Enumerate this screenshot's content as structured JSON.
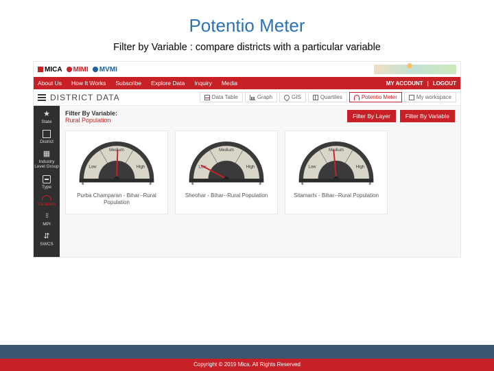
{
  "slide": {
    "title": "Potentio Meter",
    "subtitle": "Filter by Variable : compare districts with a particular variable"
  },
  "logos": {
    "mica": "MICA",
    "mimi": "MIMI",
    "mvmi": "MVMI"
  },
  "topnav": {
    "items": [
      "About Us",
      "How It Works",
      "Subscribe",
      "Explore Data",
      "Inquiry",
      "Media"
    ],
    "account": "MY ACCOUNT",
    "logout": "LOGOUT",
    "sep": " | "
  },
  "page_header": {
    "title": "DISTRICT DATA"
  },
  "viewtabs": [
    {
      "label": "Data Table",
      "active": false
    },
    {
      "label": "Graph",
      "active": false
    },
    {
      "label": "GIS",
      "active": false
    },
    {
      "label": "Quartiles",
      "active": false
    },
    {
      "label": "Potentio Meter",
      "active": true
    },
    {
      "label": "My workspace",
      "active": false
    }
  ],
  "sidenav": [
    {
      "label": "State"
    },
    {
      "label": "District"
    },
    {
      "label": "Industry Level Group"
    },
    {
      "label": "Type"
    },
    {
      "label": "Variables",
      "active": true
    },
    {
      "label": "MPI"
    },
    {
      "label": "SWCS"
    }
  ],
  "filter": {
    "label": "Filter By Variable:",
    "value": "Rural Population"
  },
  "buttons": {
    "by_layer": "Filter By Layer",
    "by_variable": "Filter By Variable"
  },
  "gauge_labels": {
    "low": "Low",
    "medium": "Medium",
    "high": "High"
  },
  "gauges": [
    {
      "caption": "Purba Champaran - Bihar--Rural Population",
      "zone": "medium",
      "angle": 88
    },
    {
      "caption": "Sheohar - Bihar--Rural Population",
      "zone": "low",
      "angle": 152
    },
    {
      "caption": "Sitamarhi - Bihar--Rural Population",
      "zone": "medium",
      "angle": 95
    }
  ],
  "footer": {
    "copyright": "Copyright © 2019 Mica. All Rights Reserved"
  },
  "chart_data": {
    "type": "gauge",
    "scale": [
      "Low",
      "Medium",
      "High"
    ],
    "series": [
      {
        "name": "Purba Champaran - Bihar - Rural Population",
        "value_zone": "Medium"
      },
      {
        "name": "Sheohar - Bihar - Rural Population",
        "value_zone": "Low"
      },
      {
        "name": "Sitamarhi - Bihar - Rural Population",
        "value_zone": "Medium"
      }
    ]
  }
}
